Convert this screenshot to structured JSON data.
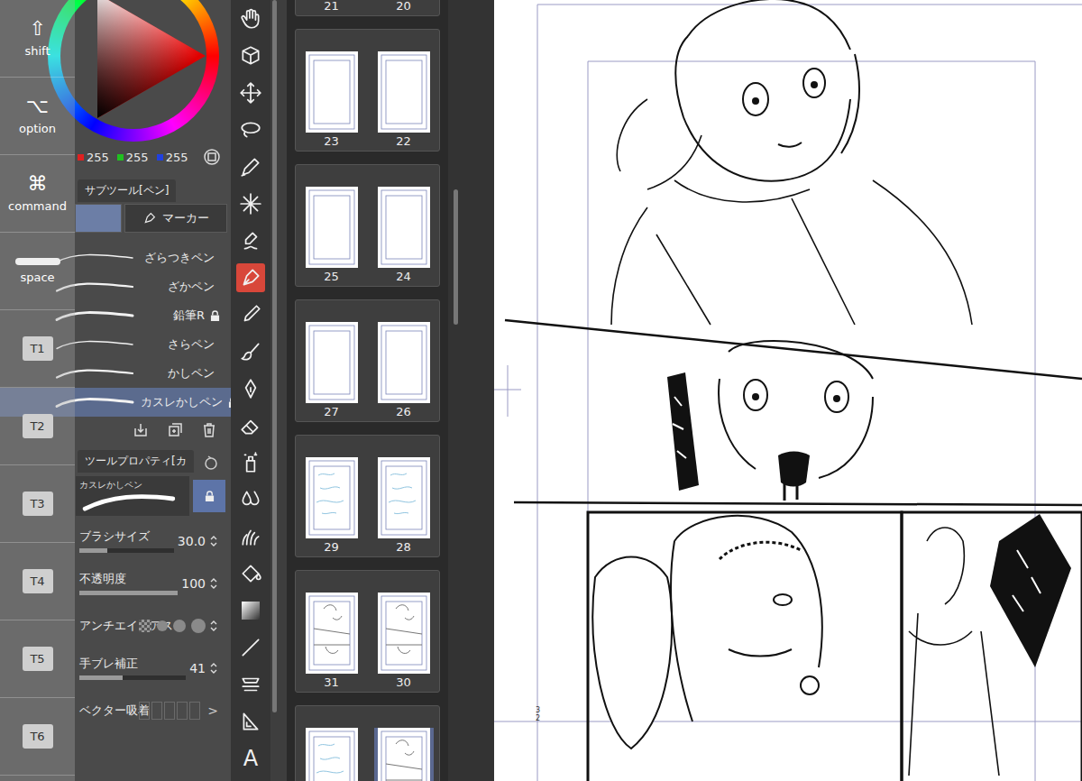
{
  "modifier_keys": [
    {
      "label": "shift",
      "icon": "⇧",
      "kind": "glyph"
    },
    {
      "label": "option",
      "icon": "⌥",
      "kind": "glyph"
    },
    {
      "label": "command",
      "icon": "⌘",
      "kind": "glyph"
    },
    {
      "label": "space",
      "icon": "",
      "kind": "bar"
    },
    {
      "label": "T1",
      "icon": "",
      "kind": "box"
    },
    {
      "label": "T2",
      "icon": "",
      "kind": "box"
    },
    {
      "label": "T3",
      "icon": "",
      "kind": "box"
    },
    {
      "label": "T4",
      "icon": "",
      "kind": "box"
    },
    {
      "label": "T5",
      "icon": "",
      "kind": "box"
    },
    {
      "label": "T6",
      "icon": "",
      "kind": "box"
    }
  ],
  "color": {
    "r": "255",
    "g": "255",
    "b": "255"
  },
  "subtool": {
    "title": "サブツール[ペン]",
    "tabs": [
      {
        "label": "",
        "selected": true
      },
      {
        "label": "マーカー",
        "selected": false
      }
    ],
    "brushes": [
      {
        "name": "ざらつきペン",
        "locked": false,
        "selected": false
      },
      {
        "name": "ざかペン",
        "locked": false,
        "selected": false
      },
      {
        "name": "鉛筆R",
        "locked": true,
        "selected": false
      },
      {
        "name": "さらペン",
        "locked": false,
        "selected": false
      },
      {
        "name": "かしペン",
        "locked": false,
        "selected": false
      },
      {
        "name": "カスレかしペン",
        "locked": true,
        "selected": true
      }
    ]
  },
  "tool_property": {
    "title": "ツールプロパティ[カ",
    "brush_name": "カスレかしペン",
    "locked": true,
    "rows": [
      {
        "label": "ブラシサイズ",
        "kind": "slider",
        "value": "30.0",
        "level": 0.3
      },
      {
        "label": "不透明度",
        "kind": "slider",
        "value": "100",
        "level": 1
      },
      {
        "label": "アンチエイリアス",
        "kind": "dots",
        "value": "",
        "level": 0
      },
      {
        "label": "手ブレ補正",
        "kind": "slider",
        "value": "41",
        "level": 0.41
      },
      {
        "label": "ベクター吸着",
        "kind": "segments",
        "value": ">",
        "level": 0
      }
    ]
  },
  "tools": [
    {
      "label": "",
      "selected": false
    },
    {
      "label": "",
      "selected": false
    },
    {
      "label": "",
      "selected": false
    },
    {
      "label": "",
      "selected": false
    },
    {
      "label": "",
      "selected": false
    },
    {
      "label": "",
      "selected": false
    },
    {
      "label": "",
      "selected": false
    },
    {
      "label": "",
      "selected": true
    },
    {
      "label": "",
      "selected": false
    },
    {
      "label": "",
      "selected": false
    },
    {
      "label": "",
      "selected": false
    },
    {
      "label": "",
      "selected": false
    },
    {
      "label": "",
      "selected": false
    },
    {
      "label": "",
      "selected": false
    },
    {
      "label": "",
      "selected": false
    },
    {
      "label": "",
      "selected": false
    },
    {
      "label": "",
      "selected": false
    },
    {
      "label": "",
      "selected": false
    },
    {
      "label": "",
      "selected": false
    },
    {
      "label": "",
      "selected": false
    },
    {
      "label": "A",
      "selected": false
    }
  ],
  "spreads": [
    {
      "pages": [
        {
          "number": "21",
          "kind": "blank",
          "selected": false
        },
        {
          "number": "20",
          "kind": "blank",
          "selected": false
        }
      ]
    },
    {
      "pages": [
        {
          "number": "23",
          "kind": "blank",
          "selected": false
        },
        {
          "number": "22",
          "kind": "blank",
          "selected": false
        }
      ]
    },
    {
      "pages": [
        {
          "number": "25",
          "kind": "blank",
          "selected": false
        },
        {
          "number": "24",
          "kind": "blank",
          "selected": false
        }
      ]
    },
    {
      "pages": [
        {
          "number": "27",
          "kind": "blank",
          "selected": false
        },
        {
          "number": "26",
          "kind": "blank",
          "selected": false
        }
      ]
    },
    {
      "pages": [
        {
          "number": "29",
          "kind": "sketch",
          "selected": false
        },
        {
          "number": "28",
          "kind": "sketch",
          "selected": false
        }
      ]
    },
    {
      "pages": [
        {
          "number": "31",
          "kind": "lineart",
          "selected": false
        },
        {
          "number": "30",
          "kind": "lineart",
          "selected": false
        }
      ]
    },
    {
      "pages": [
        {
          "number": "",
          "kind": "sketch",
          "selected": false
        },
        {
          "number": "",
          "kind": "lineart",
          "selected": true
        }
      ]
    }
  ],
  "canvas": {
    "page_number": "32"
  }
}
